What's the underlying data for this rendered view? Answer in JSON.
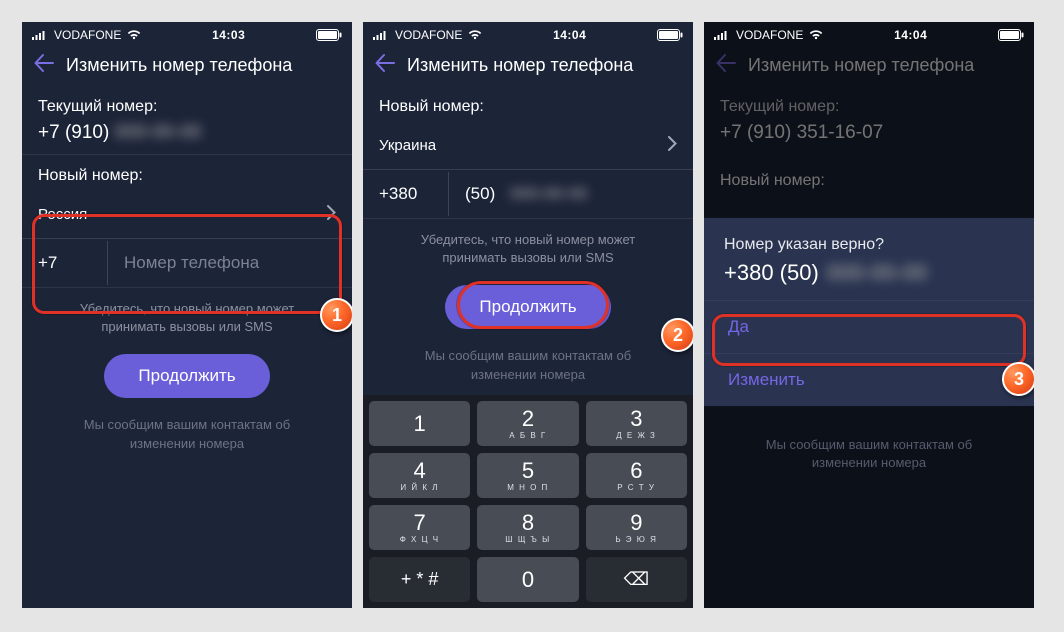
{
  "status": {
    "carrier": "VODAFONE",
    "time1": "14:03",
    "time2": "14:04",
    "time3": "14:04"
  },
  "nav_title": "Изменить номер телефона",
  "current_label": "Текущий номер:",
  "current_prefix": "+7 (910)",
  "current_rest_masked": "000-00-00",
  "current_full": "+7 (910) 351-16-07",
  "new_label": "Новый номер:",
  "screen1": {
    "country": "Россия",
    "dial_code": "+7",
    "placeholder": "Номер телефона"
  },
  "screen2": {
    "country": "Украина",
    "dial_code": "+380",
    "area": "(50)",
    "rest_masked": "000-00-00"
  },
  "hint": "Убедитесь, что новый номер может принимать вызовы или SMS",
  "continue_label": "Продолжить",
  "footer": "Мы сообщим вашим контактам об изменении номера",
  "modal": {
    "question": "Номер указан верно?",
    "number_prefix": "+380 (50)",
    "number_rest_masked": "000-00-00",
    "yes": "Да",
    "edit": "Изменить"
  },
  "keypad": [
    {
      "d": "1",
      "l": ""
    },
    {
      "d": "2",
      "l": "А Б В Г"
    },
    {
      "d": "3",
      "l": "Д Е Ж З"
    },
    {
      "d": "4",
      "l": "И Й К Л"
    },
    {
      "d": "5",
      "l": "М Н О П"
    },
    {
      "d": "6",
      "l": "Р С Т У"
    },
    {
      "d": "7",
      "l": "Ф Х Ц Ч"
    },
    {
      "d": "8",
      "l": "Ш Щ Ъ Ы"
    },
    {
      "d": "9",
      "l": "Ь Э Ю Я"
    },
    {
      "d": "+ * #",
      "l": "",
      "special": true
    },
    {
      "d": "0",
      "l": ""
    },
    {
      "d": "⌫",
      "l": "",
      "special": true
    }
  ],
  "steps": {
    "one": "1",
    "two": "2",
    "three": "3"
  }
}
